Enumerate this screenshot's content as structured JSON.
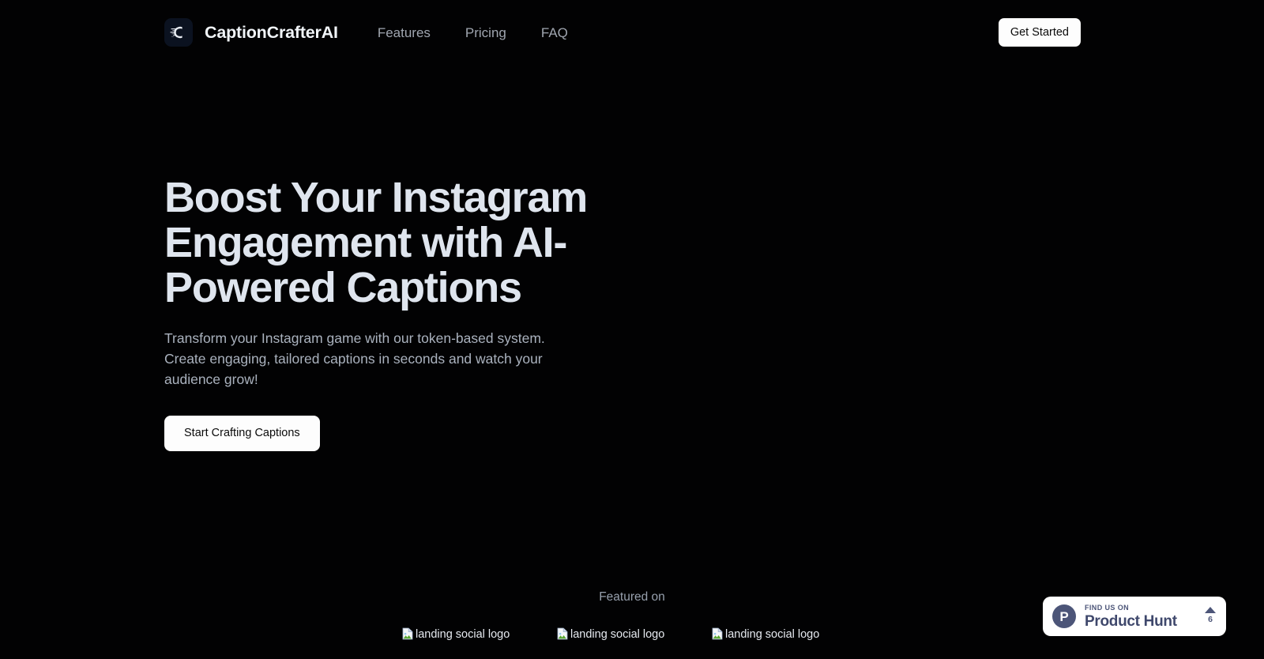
{
  "brand": {
    "name": "CaptionCrafterAI",
    "logo_icon": "caption-crafter-c-logo"
  },
  "nav": {
    "links": [
      {
        "label": "Features"
      },
      {
        "label": "Pricing"
      },
      {
        "label": "FAQ"
      }
    ],
    "cta_label": "Get Started"
  },
  "hero": {
    "title": "Boost Your Instagram Engagement with AI-Powered Captions",
    "subtitle": "Transform your Instagram game with our token-based system. Create engaging, tailored captions in seconds and watch your audience grow!",
    "cta_label": "Start Crafting Captions"
  },
  "featured": {
    "label": "Featured on",
    "logos": [
      {
        "alt": "landing social logo",
        "icon": "broken-image-icon"
      },
      {
        "alt": "landing social logo",
        "icon": "broken-image-icon"
      },
      {
        "alt": "landing social logo",
        "icon": "broken-image-icon"
      }
    ]
  },
  "product_hunt": {
    "kicker": "FIND US ON",
    "name": "Product Hunt",
    "vote_count": "6",
    "logo_letter": "P",
    "upvote_icon": "caret-up-icon"
  },
  "colors": {
    "background": "#020203",
    "heading": "#dfe5ee",
    "body_text": "#aab2be",
    "nav_link": "#a0a6b0",
    "button_bg": "#fdfdfd",
    "button_text": "#0a0a0a",
    "product_hunt_accent": "#4c5578",
    "logo_tile": "#0b1220"
  }
}
